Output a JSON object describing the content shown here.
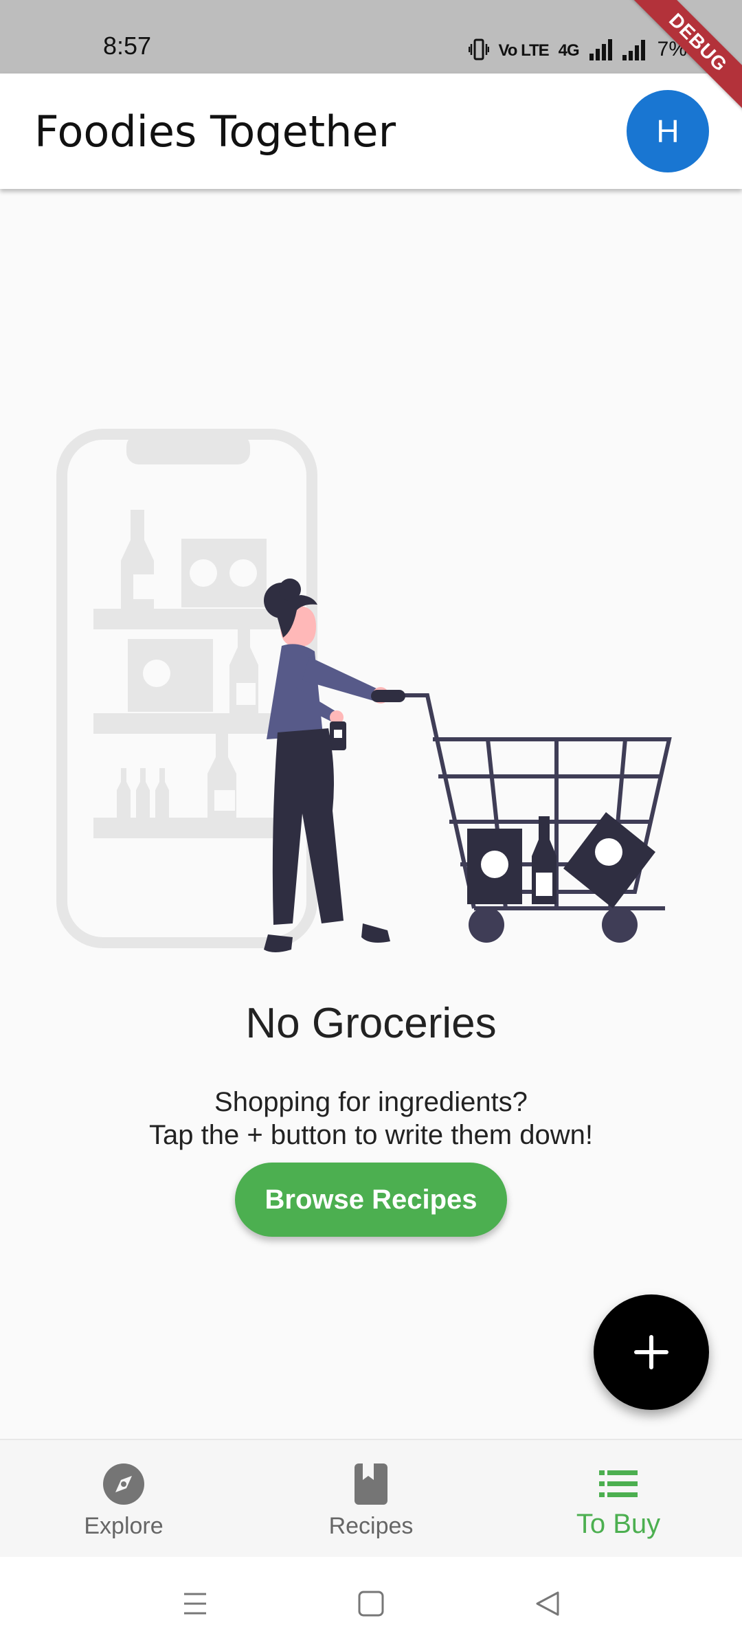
{
  "status_bar": {
    "time": "8:57",
    "volte": "Vo LTE",
    "network": "4G",
    "battery": "7%"
  },
  "debug_banner": "DEBUG",
  "app_bar": {
    "title": "Foodies Together",
    "avatar_initial": "H",
    "avatar_color": "#1976d2"
  },
  "empty_state": {
    "title": "No Groceries",
    "subtitle_line1": "Shopping for ingredients?",
    "subtitle_line2": "Tap the + button to write them down!",
    "button_label": "Browse Recipes",
    "illustration_icon": "shopping-cart-illustration"
  },
  "fab": {
    "icon": "plus-icon"
  },
  "bottom_nav": {
    "items": [
      {
        "label": "Explore",
        "icon": "compass-icon",
        "active": false
      },
      {
        "label": "Recipes",
        "icon": "book-icon",
        "active": false
      },
      {
        "label": "To Buy",
        "icon": "list-icon",
        "active": true
      }
    ],
    "active_color": "#4caf50",
    "inactive_color": "#666666"
  },
  "system_nav": [
    "menu-icon",
    "home-icon",
    "back-icon"
  ],
  "colors": {
    "accent": "#4caf50",
    "fab": "#000000",
    "background": "#fafafa"
  }
}
